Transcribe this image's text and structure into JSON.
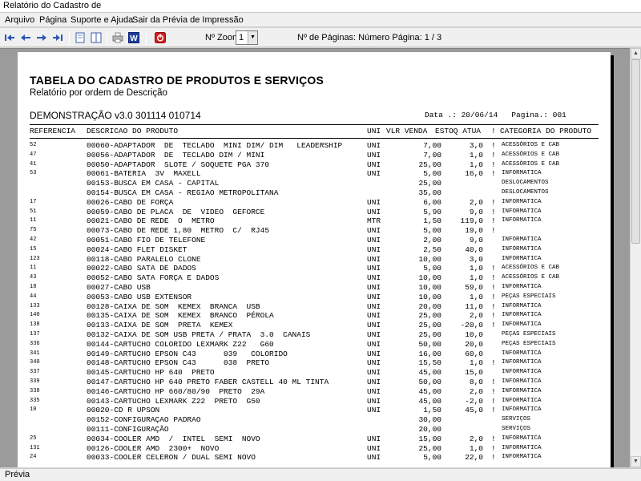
{
  "window": {
    "title": "Relatório do Cadastro de"
  },
  "menu": [
    "Arquivo",
    "Página",
    "Suporte e Ajuda",
    "Sair da Prévia de Impressão"
  ],
  "toolbar": {
    "zoom_label": "Nº Zoom",
    "zoom_value": "1",
    "pages_label": "Nº de Páginas: Número Página: 1 / 3",
    "icons": [
      "first-page-icon",
      "previous-page-icon",
      "next-page-icon",
      "last-page-icon",
      "single-page-icon",
      "two-pages-icon",
      "print-icon",
      "export-word-icon",
      "close-preview-icon"
    ]
  },
  "report": {
    "title": "TABELA DO CADASTRO DE PRODUTOS E SERVIÇOS",
    "subtitle": "Relatório por ordem de Descrição",
    "demo": "DEMONSTRAÇÃO v3.0 301114 010714",
    "date_label": "Data .: 20/06/14",
    "page_label": "Pagina.: 001",
    "headers": {
      "ref": "REFERENCIA",
      "desc": "DESCRICAO DO PRODUTO",
      "un": "UNI",
      "vlr": "VLR VENDA",
      "est": "ESTOQ ATUA",
      "bang": "!",
      "cat": "CATEGORIA DO PRODUTO"
    },
    "rows": [
      {
        "ref": "52",
        "desc": "00060-ADAPTADOR  DE  TECLADO  MINI DIM/ DIM   LEADERSHIP",
        "un": "UNI",
        "vlr": "7,00",
        "est": "3,0",
        "bang": "!",
        "cat": "ACESSÓRIOS E CAB"
      },
      {
        "ref": "47",
        "desc": "00056-ADAPTADOR  DE  TECLADO DIM / MINI",
        "un": "UNI",
        "vlr": "7,00",
        "est": "1,0",
        "bang": "!",
        "cat": "ACESSÓRIOS E CAB"
      },
      {
        "ref": "41",
        "desc": "00050-ADAPTADOR  SLOTE / SOQUETE PGA 370",
        "un": "UNI",
        "vlr": "25,00",
        "est": "1,0",
        "bang": "!",
        "cat": "ACESSÓRIOS E CAB"
      },
      {
        "ref": "53",
        "desc": "00061-BATERIA  3V  MAXELL",
        "un": "UNI",
        "vlr": "5,00",
        "est": "16,0",
        "bang": "!",
        "cat": "INFORMATICA"
      },
      {
        "ref": "",
        "desc": "00153-BUSCA EM CASA - CAPITAL",
        "un": "",
        "vlr": "25,00",
        "est": "",
        "bang": "",
        "cat": "DESLOCAMENTOS"
      },
      {
        "ref": "",
        "desc": "00154-BUSCA EM CASA - REGIAO METROPOLITANA",
        "un": "",
        "vlr": "35,00",
        "est": "",
        "bang": "",
        "cat": "DESLOCAMENTOS"
      },
      {
        "ref": "17",
        "desc": "00026-CABO DE FORÇA",
        "un": "UNI",
        "vlr": "6,00",
        "est": "2,0",
        "bang": "!",
        "cat": "INFORMATICA"
      },
      {
        "ref": "51",
        "desc": "00059-CABO DE PLACA  DE  VIDEO  GEFORCE",
        "un": "UNI",
        "vlr": "5,90",
        "est": "9,0",
        "bang": "!",
        "cat": "INFORMATICA"
      },
      {
        "ref": "11",
        "desc": "00021-CABO DE REDE  O  METRO",
        "un": "MTR",
        "vlr": "1,50",
        "est": "119,0",
        "bang": "!",
        "cat": "INFORMATICA"
      },
      {
        "ref": "75",
        "desc": "00073-CABO DE REDE 1,80  METRO  C/  RJ45",
        "un": "UNI",
        "vlr": "5,00",
        "est": "19,0",
        "bang": "!",
        "cat": ""
      },
      {
        "ref": "42",
        "desc": "00051-CABO FIO DE TELEFONE",
        "un": "UNI",
        "vlr": "2,00",
        "est": "9,0",
        "bang": "",
        "cat": "INFORMATICA"
      },
      {
        "ref": "15",
        "desc": "00024-CABO FLET DISKET",
        "un": "UNI",
        "vlr": "2,50",
        "est": "40,0",
        "bang": "",
        "cat": "INFORMATICA"
      },
      {
        "ref": "123",
        "desc": "00118-CABO PARALELO CLONE",
        "un": "UNI",
        "vlr": "10,00",
        "est": "3,0",
        "bang": "",
        "cat": "INFORMATICA"
      },
      {
        "ref": "11",
        "desc": "00022-CABO SATA DE DADOS",
        "un": "UNI",
        "vlr": "5,00",
        "est": "1,0",
        "bang": "!",
        "cat": "ACESSÓRIOS E CAB"
      },
      {
        "ref": "43",
        "desc": "00052-CABO SATA FORÇA E DADOS",
        "un": "UNI",
        "vlr": "10,00",
        "est": "1,0",
        "bang": "!",
        "cat": "ACESSÓRIOS E CAB"
      },
      {
        "ref": "18",
        "desc": "00027-CABO USB",
        "un": "UNI",
        "vlr": "10,00",
        "est": "59,0",
        "bang": "!",
        "cat": "INFORMATICA"
      },
      {
        "ref": "44",
        "desc": "00053-CABO USB EXTENSOR",
        "un": "UNI",
        "vlr": "10,00",
        "est": "1,0",
        "bang": "!",
        "cat": "PEÇAS ESPECIAIS"
      },
      {
        "ref": "133",
        "desc": "00128-CAIXA DE SOM  KEMEX  BRANCA  USB",
        "un": "UNI",
        "vlr": "20,00",
        "est": "11,0",
        "bang": "!",
        "cat": "INFORMATICA"
      },
      {
        "ref": "140",
        "desc": "00135-CAIXA DE SOM  KEMEX  BRANCO  PÉROLA",
        "un": "UNI",
        "vlr": "25,00",
        "est": "2,0",
        "bang": "!",
        "cat": "INFORMATICA"
      },
      {
        "ref": "138",
        "desc": "00133-CAIXA DE SOM  PRETA  KEMEX",
        "un": "UNI",
        "vlr": "25,00",
        "est": "-20,0",
        "bang": "!",
        "cat": "INFORMATICA"
      },
      {
        "ref": "137",
        "desc": "00132-CAIXA DE SOM USB PRETA / PRATA  3.0  CANAIS",
        "un": "UNI",
        "vlr": "25,00",
        "est": "10,0",
        "bang": "",
        "cat": "PEÇAS ESPECIAIS"
      },
      {
        "ref": "336",
        "desc": "00144-CARTUCHO COLORIDO LEXMARK Z22   G60",
        "un": "UNI",
        "vlr": "50,00",
        "est": "20,0",
        "bang": "",
        "cat": "PEÇAS ESPECIAIS"
      },
      {
        "ref": "341",
        "desc": "00149-CARTUCHO EPSON C43      039   COLORIDO",
        "un": "UNI",
        "vlr": "16,00",
        "est": "60,0",
        "bang": "",
        "cat": "INFORMATICA"
      },
      {
        "ref": "340",
        "desc": "00148-CARTUCHO EPSON C43      038  PRETO",
        "un": "UNI",
        "vlr": "15,50",
        "est": "1,0",
        "bang": "!",
        "cat": "INFORMATICA"
      },
      {
        "ref": "337",
        "desc": "00145-CARTUCHO HP 640  PRETO",
        "un": "UNI",
        "vlr": "45,00",
        "est": "15,0",
        "bang": "",
        "cat": "INFORMATICA"
      },
      {
        "ref": "339",
        "desc": "00147-CARTUCHO HP 640 PRETO FABER CASTELL 40 ML TINTA",
        "un": "UNI",
        "vlr": "50,00",
        "est": "8,0",
        "bang": "!",
        "cat": "INFORMATICA"
      },
      {
        "ref": "338",
        "desc": "00146-CARTUCHO HP 660/80/90  PRETO  29A",
        "un": "UNI",
        "vlr": "45,00",
        "est": "2,0",
        "bang": "!",
        "cat": "INFORMATICA"
      },
      {
        "ref": "335",
        "desc": "00143-CARTUCHO LEXMARK Z22  PRETO  G50",
        "un": "UNI",
        "vlr": "45,00",
        "est": "-2,0",
        "bang": "!",
        "cat": "INFORMATICA"
      },
      {
        "ref": "10",
        "desc": "00020-CD R UPSON",
        "un": "UNI",
        "vlr": "1,50",
        "est": "45,0",
        "bang": "!",
        "cat": "INFORMATICA"
      },
      {
        "ref": "",
        "desc": "00152-CONFIGURAÇAO PADRAO",
        "un": "",
        "vlr": "30,00",
        "est": "",
        "bang": "",
        "cat": "SERVIÇOS"
      },
      {
        "ref": "",
        "desc": "00111-CONFIGURAÇÃO",
        "un": "",
        "vlr": "20,00",
        "est": "",
        "bang": "",
        "cat": "SERVIÇOS"
      },
      {
        "ref": "25",
        "desc": "00034-COOLER AMD  /  INTEL  SEMI  NOVO",
        "un": "UNI",
        "vlr": "15,00",
        "est": "2,0",
        "bang": "!",
        "cat": "INFORMATICA"
      },
      {
        "ref": "131",
        "desc": "00126-COOLER AMD  2300+  NOVO",
        "un": "UNI",
        "vlr": "25,00",
        "est": "1,0",
        "bang": "!",
        "cat": "INFORMATICA"
      },
      {
        "ref": "24",
        "desc": "00033-COOLER CELERON / DUAL SEMI NOVO",
        "un": "UNI",
        "vlr": "5,00",
        "est": "22,0",
        "bang": "!",
        "cat": "INFORMATICA"
      }
    ]
  },
  "status": {
    "text": "Prévia"
  }
}
